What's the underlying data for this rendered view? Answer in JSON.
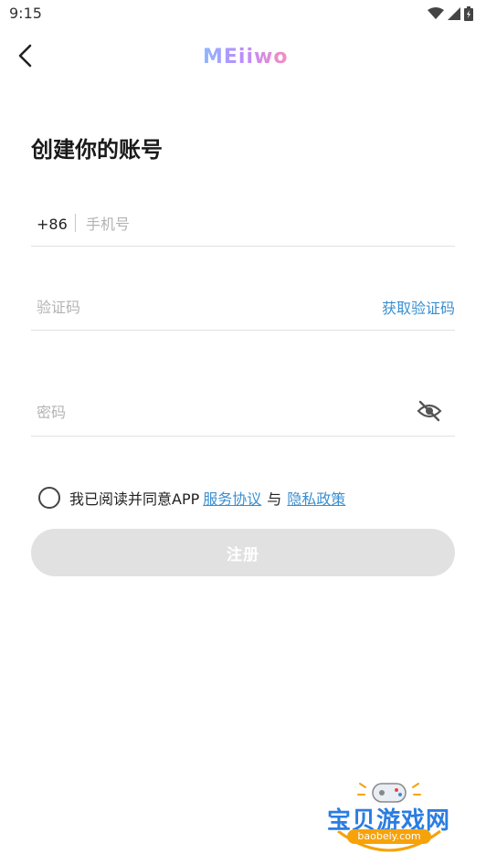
{
  "status_bar": {
    "time": "9:15"
  },
  "header": {
    "logo_text": "MEiiwo",
    "back_icon": "chevron-left-icon"
  },
  "page": {
    "title": "创建你的账号"
  },
  "phone": {
    "country_code": "+86",
    "placeholder": "手机号"
  },
  "code": {
    "placeholder": "验证码",
    "get_code_label": "获取验证码"
  },
  "password": {
    "placeholder": "密码",
    "toggle_icon": "eye-off-icon"
  },
  "agreement": {
    "prefix": "我已阅读并同意APP",
    "service_link": "服务协议",
    "conjunction": "与",
    "privacy_link": "隐私政策"
  },
  "register_button": {
    "label": "注册"
  },
  "watermark": {
    "text": "宝贝游戏网",
    "url": "baobeiy.com"
  },
  "colors": {
    "accent": "#3a8fd1",
    "button_disabled": "#e1e1e1",
    "watermark_blue": "#2a7de1",
    "watermark_orange": "#f6a20a"
  }
}
